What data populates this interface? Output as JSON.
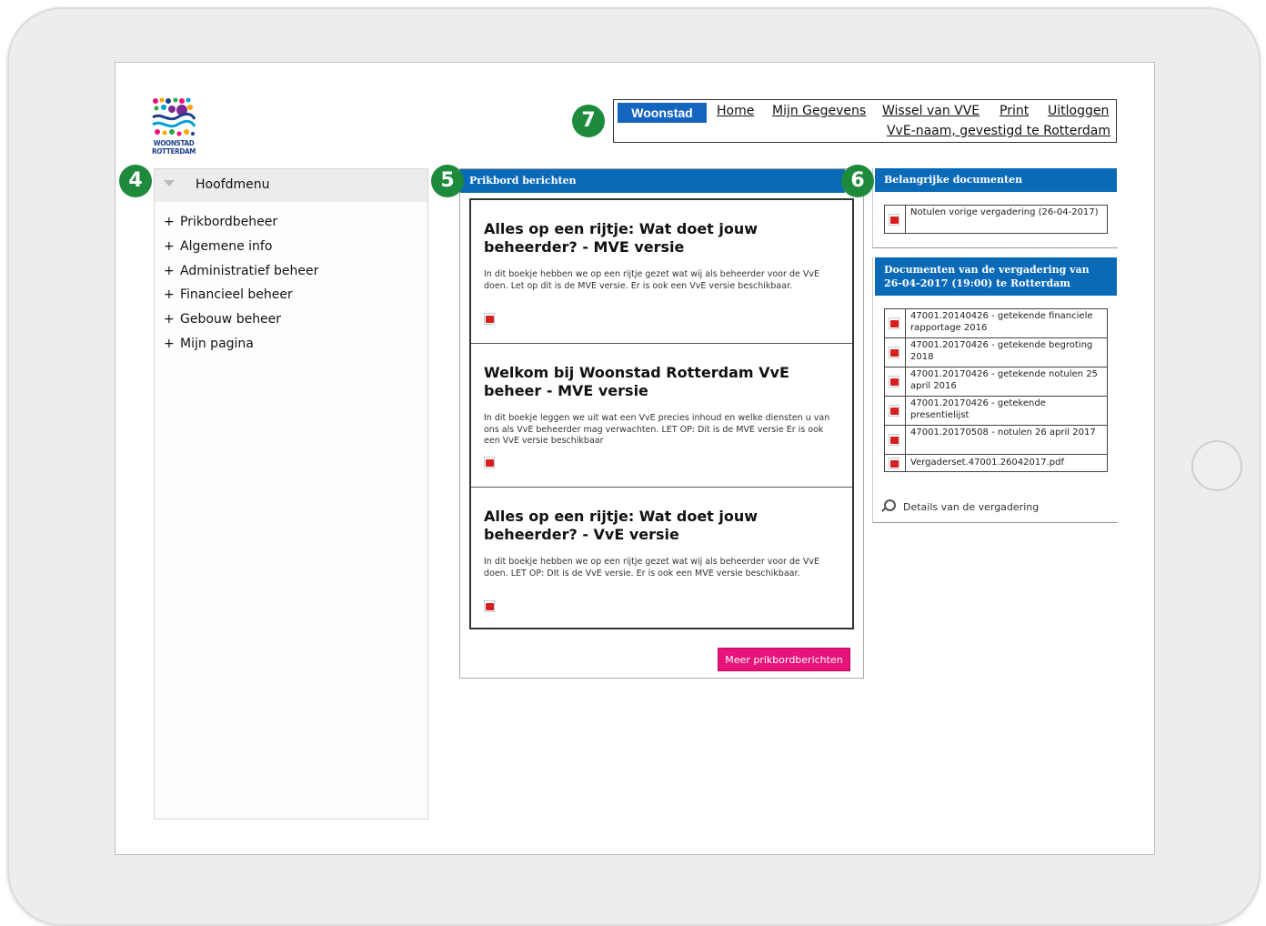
{
  "logo": {
    "text_line1": "WOONSTAD",
    "text_line2": "ROTTERDAM"
  },
  "badges": {
    "sidebar": "4",
    "prikbord": "5",
    "documenten": "6",
    "nav": "7"
  },
  "nav": {
    "brand": "Woonstad",
    "links": [
      "Home",
      "Mijn Gegevens",
      "Wissel van VVE",
      "Print",
      "Uitloggen"
    ],
    "subtitle": "VvE-naam, gevestigd te Rotterdam"
  },
  "sidebar": {
    "title": "Hoofdmenu",
    "items": [
      {
        "plus": "+",
        "label": "Prikbordbeheer"
      },
      {
        "plus": "+",
        "label": "Algemene info"
      },
      {
        "plus": "+",
        "label": "Administratief beheer"
      },
      {
        "plus": "+",
        "label": "Financieel beheer"
      },
      {
        "plus": "+",
        "label": "Gebouw beheer"
      },
      {
        "plus": "+",
        "label": "Mijn pagina"
      }
    ]
  },
  "prikbord": {
    "header": "Prikbord berichten",
    "items": [
      {
        "title": "Alles op een rijtje: Wat doet jouw beheerder? - MVE versie",
        "text": "In dit boekje hebben we op een rijtje gezet wat wij als beheerder voor de VvE doen. Let op dit is de MVE versie. Er is ook een VvE versie beschikbaar."
      },
      {
        "title": "Welkom bij Woonstad Rotterdam VvE beheer - MVE versie",
        "text": "In dit boekje leggen we uit wat een VvE precies inhoud en welke diensten u van ons als VvE beheerder mag verwachten. LET OP: Dit is de MVE versie Er is ook een VvE versie beschikbaar"
      },
      {
        "title": "Alles op een rijtje: Wat doet jouw beheerder? - VvE versie",
        "text": "In dit boekje hebben we op een rijtje gezet wat wij als beheerder voor de VvE doen. LET OP: DIt is de VvE versie. Er is ook een MVE versie beschikbaar."
      }
    ],
    "more_button": "Meer prikbordberichten"
  },
  "belangrijke": {
    "header": "Belangrijke documenten",
    "docs": [
      "Notulen vorige vergadering (26-04-2017)"
    ]
  },
  "vergadering": {
    "header_line1": "Documenten van de vergadering van",
    "header_line2": "26-04-2017 (19:00) te Rotterdam",
    "docs": [
      "47001.20140426 - getekende financiele rapportage 2016",
      "47001.20170426 - getekende begroting 2018",
      "47001.20170426 - getekende notulen 25 april 2016",
      "47001.20170426 - getekende presentielijst",
      "47001.20170508 - notulen 26 april 2017",
      "Vergaderset.47001.26042017.pdf"
    ],
    "details_label": "Details van de vergadering"
  },
  "colors": {
    "accent_blue": "#0b6ab8",
    "brand_blue": "#1565c0",
    "badge_green": "#1d8a3c",
    "button_pink": "#e8137a"
  }
}
